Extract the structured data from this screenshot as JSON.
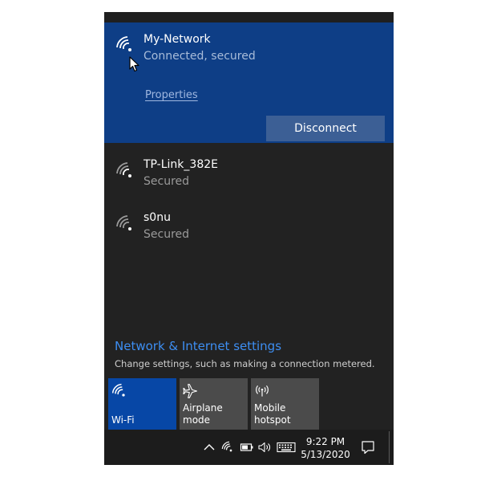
{
  "connected_network": {
    "name": "My-Network",
    "status": "Connected, secured",
    "properties_label": "Properties",
    "disconnect_label": "Disconnect"
  },
  "networks": [
    {
      "name": "TP-Link_382E",
      "status": "Secured"
    },
    {
      "name": "s0nu",
      "status": "Secured"
    }
  ],
  "settings": {
    "link_label": "Network & Internet settings",
    "description": "Change settings, such as making a connection metered."
  },
  "quick_actions": [
    {
      "label": "Wi-Fi",
      "icon": "wifi-icon",
      "active": true
    },
    {
      "label": "Airplane mode",
      "icon": "airplane-icon",
      "active": false
    },
    {
      "label": "Mobile\nhotspot",
      "icon": "hotspot-icon",
      "active": false
    }
  ],
  "taskbar": {
    "time": "9:22 PM",
    "date": "5/13/2020"
  },
  "colors": {
    "accent": "#0747a6",
    "connected_bg": "#0e3e86",
    "link": "#3d8ef2"
  }
}
